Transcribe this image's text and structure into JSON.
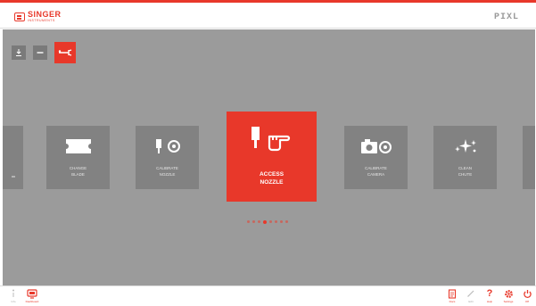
{
  "brand": {
    "name": "SINGER",
    "sub": "INSTRUMENTS",
    "product": "PIXL"
  },
  "colors": {
    "accent": "#e8382a",
    "panel": "#9b9b9b",
    "card": "#828282"
  },
  "toolbar": [
    {
      "icon": "download-icon",
      "active": false
    },
    {
      "icon": "minus-icon",
      "active": false
    },
    {
      "icon": "swab-tool-icon",
      "active": true
    }
  ],
  "carousel": {
    "cards": [
      {
        "label": "",
        "icon": "partial-card-icon"
      },
      {
        "label": "CHANGE\nBLADE",
        "icon": "blade-icon"
      },
      {
        "label": "CALIBRATE\nNOZZLE",
        "icon": "nozzle-target-icon"
      },
      {
        "label": "ACCESS\nNOZZLE",
        "icon": "nozzle-hand-icon",
        "featured": true
      },
      {
        "label": "CALIBRATE\nCAMERA",
        "icon": "camera-target-icon"
      },
      {
        "label": "CLEAN\nCHUTE",
        "icon": "sparkle-icon"
      },
      {
        "label": "",
        "icon": "partial-card-icon"
      }
    ],
    "page_count": 8,
    "active_page": 4
  },
  "footer": {
    "left": [
      {
        "label": "Info",
        "icon": "info-icon"
      },
      {
        "label": "Dashboard",
        "icon": "monitor-icon"
      }
    ],
    "right": [
      {
        "label": "Docs",
        "icon": "document-icon"
      },
      {
        "label": "Edit",
        "icon": "pencil-icon"
      },
      {
        "label": "Help",
        "icon": "help-icon"
      },
      {
        "label": "Settings",
        "icon": "gear-icon"
      },
      {
        "label": "Off",
        "icon": "power-icon"
      }
    ]
  }
}
